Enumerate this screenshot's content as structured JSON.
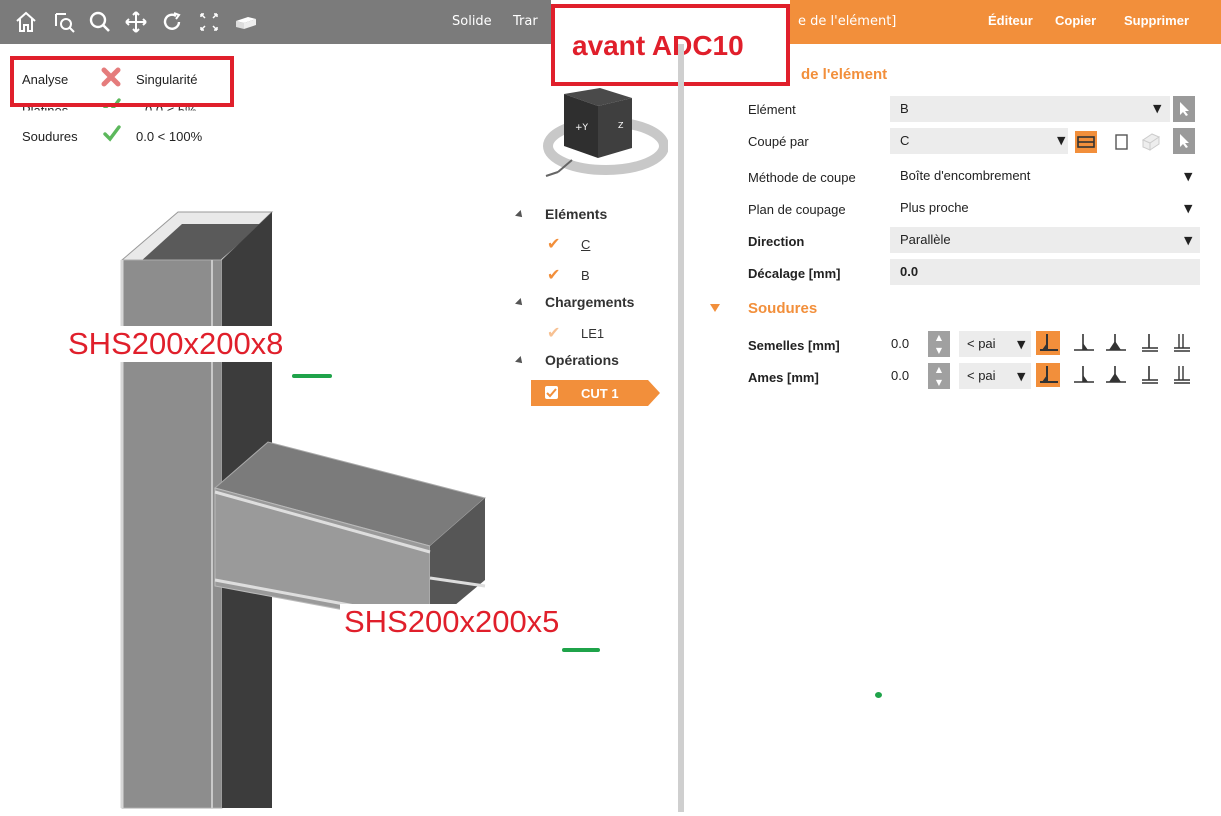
{
  "toolbar": {
    "icons": [
      "home-icon",
      "zoom-window-icon",
      "search-icon",
      "pan-icon",
      "rotate-icon",
      "zoom-extents-icon",
      "solid-view-icon"
    ],
    "solid_label": "Solide",
    "transparent_label": "Trar"
  },
  "header": {
    "element_title": "e de l'elément]",
    "edit_label": "Éditeur",
    "copy_label": "Copier",
    "delete_label": "Supprimer"
  },
  "annotation": {
    "adc_label": "avant ADC10",
    "column_profile": "SHS200x200x8",
    "beam_profile": "SHS200x200x5"
  },
  "summary": {
    "analyse_label": "Analyse",
    "analyse_status": "Singularité",
    "platines_label": "Platines",
    "platines_value": "0.0 < 5%",
    "soudures_label": "Soudures",
    "soudures_value": "0.0 < 100%"
  },
  "tree": {
    "elements_header": "Eléments",
    "element_items": [
      "C",
      "B"
    ],
    "loads_header": "Chargements",
    "load_items": [
      "LE1"
    ],
    "operations_header": "Opérations",
    "operation_items": [
      "CUT 1"
    ]
  },
  "properties": {
    "section_title": "de l'elément",
    "element_label": "Elément",
    "element_value": "B",
    "cut_by_label": "Coupé par",
    "cut_by_value": "C",
    "cut_method_label": "Méthode de coupe",
    "cut_method_value": "Boîte d'encombrement",
    "cut_plane_label": "Plan de coupage",
    "cut_plane_value": "Plus proche",
    "direction_label": "Direction",
    "direction_value": "Parallèle",
    "offset_label": "Décalage [mm]",
    "offset_value": "0.0"
  },
  "welds": {
    "section_title": "Soudures",
    "flanges_label": "Semelles [mm]",
    "flanges_value": "0.0",
    "flanges_type": "< pai",
    "webs_label": "Ames [mm]",
    "webs_value": "0.0",
    "webs_type": "< pai"
  },
  "colors": {
    "accent": "#f28f3b",
    "toolbar": "#7b7b7b",
    "annotation_red": "#e01f2b",
    "check_green": "#5cb85c"
  }
}
